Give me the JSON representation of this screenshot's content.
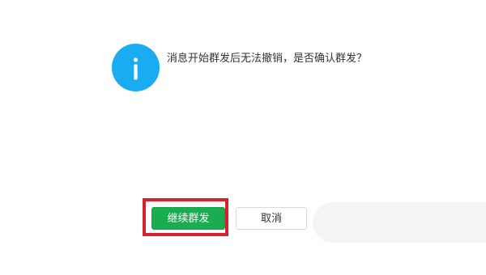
{
  "dialog": {
    "icon": "info-icon",
    "message": "消息开始群发后无法撤销，是否确认群发？",
    "confirm_label": "继续群发",
    "cancel_label": "取消"
  },
  "colors": {
    "info_icon": "#1aacf0",
    "confirm_button": "#1aad4f",
    "highlight_border": "#d4232c"
  }
}
